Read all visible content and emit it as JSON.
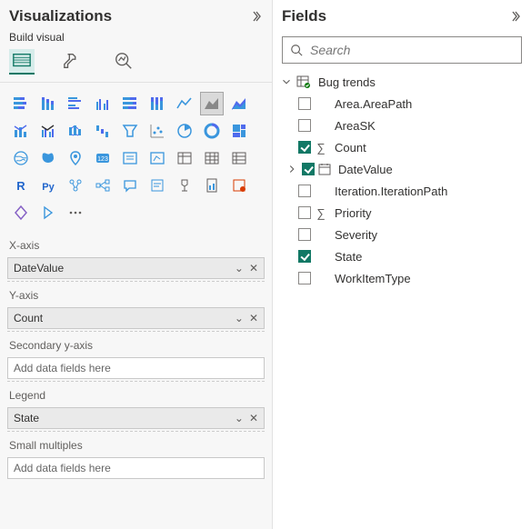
{
  "viz": {
    "title": "Visualizations",
    "build_label": "Build visual",
    "wells": {
      "x_axis": {
        "label": "X-axis",
        "value": "DateValue"
      },
      "y_axis": {
        "label": "Y-axis",
        "value": "Count"
      },
      "secondary_y": {
        "label": "Secondary y-axis",
        "placeholder": "Add data fields here"
      },
      "legend": {
        "label": "Legend",
        "value": "State"
      },
      "small_multiples": {
        "label": "Small multiples",
        "placeholder": "Add data fields here"
      }
    }
  },
  "fields": {
    "title": "Fields",
    "search_placeholder": "Search",
    "table": "Bug trends",
    "items": {
      "area_path": "Area.AreaPath",
      "area_sk": "AreaSK",
      "count": "Count",
      "date_value": "DateValue",
      "iteration_path": "Iteration.IterationPath",
      "priority": "Priority",
      "severity": "Severity",
      "state": "State",
      "work_item_type": "WorkItemType"
    }
  }
}
